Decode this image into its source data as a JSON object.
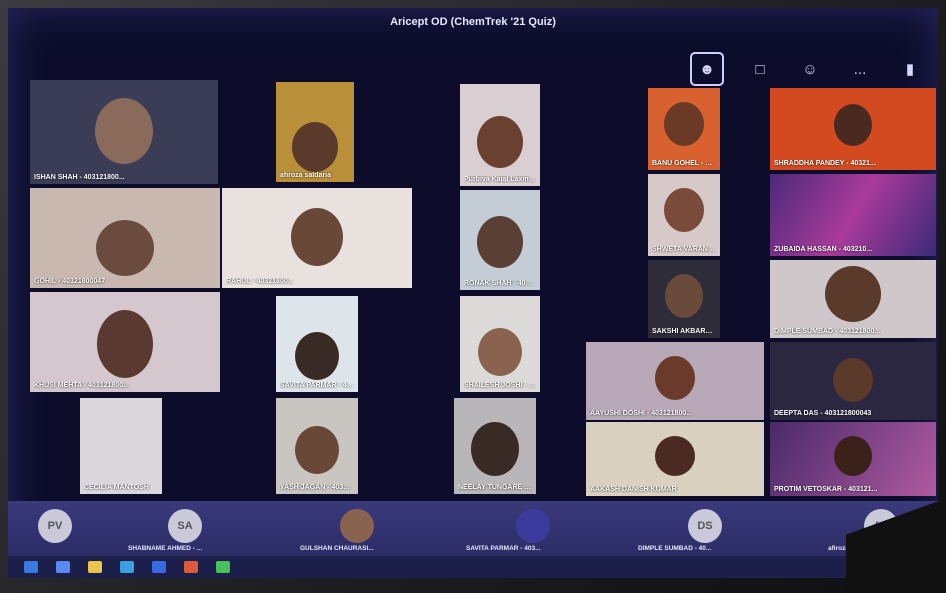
{
  "window": {
    "title": "Aricept OD (ChemTrek '21 Quiz)"
  },
  "toolbar": {
    "icons": [
      "participants-icon",
      "chat-icon",
      "reactions-icon",
      "more-icon",
      "camera-icon"
    ],
    "more_label": "..."
  },
  "tiles": [
    {
      "name": "ISHAN SHAH - 403121800..."
    },
    {
      "name": "afiroza saldaria"
    },
    {
      "name": "Purbiya Kajal Laxman"
    },
    {
      "name": "BANU GOHEL - 40321800..."
    },
    {
      "name": "SHRADDHA PANDEY - 40321..."
    },
    {
      "name": "GOHIL - 40321800047"
    },
    {
      "name": "RAHUL - 40321800..."
    },
    {
      "name": "RONAK SHAH - 403121800230"
    },
    {
      "name": "SHWETA VARAN - 403121800241"
    },
    {
      "name": "ZUBAIDA HASSAN - 403210..."
    },
    {
      "name": "SAKSHI AKBARALI - 403121..."
    },
    {
      "name": "DIMPLE SUMBAD - 403121800..."
    },
    {
      "name": "KHUSI MEHTA - 403121800..."
    },
    {
      "name": "SAVITA PARMAR - 403121800..."
    },
    {
      "name": "SHAILESH JOSHI - 40321218..."
    },
    {
      "name": "AAYUSHI DOSHI - 403121800..."
    },
    {
      "name": "DEEPTA DAS - 403121800043"
    },
    {
      "name": "CECILIA MANTOSH"
    },
    {
      "name": "YASH JAGAN - 403121800487"
    },
    {
      "name": "NEELAY TUNGARE - 4031219..."
    },
    {
      "name": "AAKASH DANISH KUMAR"
    },
    {
      "name": "PROTIM VETOSKAR - 403121..."
    }
  ],
  "bottom_participants": [
    {
      "initials": "PV",
      "name": ""
    },
    {
      "initials": "SA",
      "name": "SHABNAME AHMED - ..."
    },
    {
      "initials": "",
      "name": "GULSHAN CHAURASI..."
    },
    {
      "initials": "",
      "name": "SAVITA PARMAR - 403..."
    },
    {
      "initials": "DS",
      "name": "DIMPLE SUMBAD - 40..."
    },
    {
      "initials": "AS",
      "name": "afiroza saldaria..."
    }
  ]
}
